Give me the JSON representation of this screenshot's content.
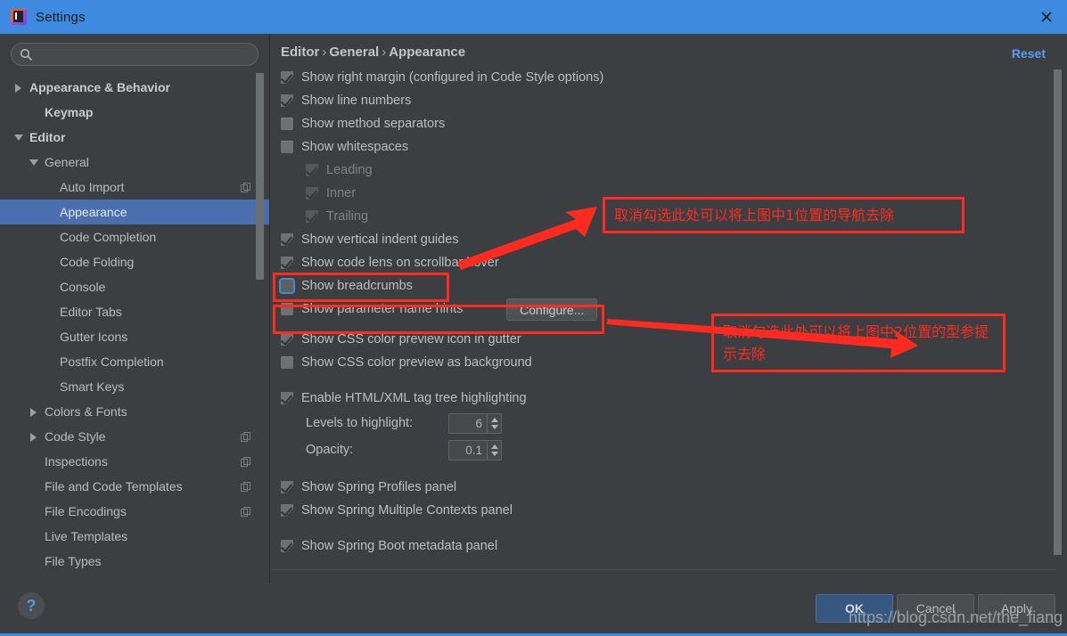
{
  "window": {
    "title": "Settings",
    "icon": "intellij-idea-icon",
    "close_label": "×"
  },
  "sidebar": {
    "search": {
      "placeholder": "",
      "value": "",
      "icon": "search-icon"
    },
    "items": [
      {
        "label": "Appearance & Behavior",
        "indent": 0,
        "arrow": "right",
        "bold": true,
        "selected": false,
        "copy": false
      },
      {
        "label": "Keymap",
        "indent": 1,
        "arrow": "none",
        "bold": true,
        "selected": false,
        "copy": false
      },
      {
        "label": "Editor",
        "indent": 0,
        "arrow": "down",
        "bold": true,
        "selected": false,
        "copy": false
      },
      {
        "label": "General",
        "indent": 1,
        "arrow": "down",
        "bold": false,
        "selected": false,
        "copy": false
      },
      {
        "label": "Auto Import",
        "indent": 2,
        "arrow": "none",
        "bold": false,
        "selected": false,
        "copy": true
      },
      {
        "label": "Appearance",
        "indent": 2,
        "arrow": "none",
        "bold": false,
        "selected": true,
        "copy": false
      },
      {
        "label": "Code Completion",
        "indent": 2,
        "arrow": "none",
        "bold": false,
        "selected": false,
        "copy": false
      },
      {
        "label": "Code Folding",
        "indent": 2,
        "arrow": "none",
        "bold": false,
        "selected": false,
        "copy": false
      },
      {
        "label": "Console",
        "indent": 2,
        "arrow": "none",
        "bold": false,
        "selected": false,
        "copy": false
      },
      {
        "label": "Editor Tabs",
        "indent": 2,
        "arrow": "none",
        "bold": false,
        "selected": false,
        "copy": false
      },
      {
        "label": "Gutter Icons",
        "indent": 2,
        "arrow": "none",
        "bold": false,
        "selected": false,
        "copy": false
      },
      {
        "label": "Postfix Completion",
        "indent": 2,
        "arrow": "none",
        "bold": false,
        "selected": false,
        "copy": false
      },
      {
        "label": "Smart Keys",
        "indent": 2,
        "arrow": "none",
        "bold": false,
        "selected": false,
        "copy": false
      },
      {
        "label": "Colors & Fonts",
        "indent": 1,
        "arrow": "right",
        "bold": false,
        "selected": false,
        "copy": false
      },
      {
        "label": "Code Style",
        "indent": 1,
        "arrow": "right",
        "bold": false,
        "selected": false,
        "copy": true
      },
      {
        "label": "Inspections",
        "indent": 1,
        "arrow": "none",
        "bold": false,
        "selected": false,
        "copy": true
      },
      {
        "label": "File and Code Templates",
        "indent": 1,
        "arrow": "none",
        "bold": false,
        "selected": false,
        "copy": true
      },
      {
        "label": "File Encodings",
        "indent": 1,
        "arrow": "none",
        "bold": false,
        "selected": false,
        "copy": true
      },
      {
        "label": "Live Templates",
        "indent": 1,
        "arrow": "none",
        "bold": false,
        "selected": false,
        "copy": false
      },
      {
        "label": "File Types",
        "indent": 1,
        "arrow": "none",
        "bold": false,
        "selected": false,
        "copy": false
      }
    ]
  },
  "content": {
    "breadcrumb": {
      "part1": "Editor",
      "part2": "General",
      "part3": "Appearance",
      "separator": "›"
    },
    "reset_label": "Reset",
    "options": [
      {
        "label": "Show right margin (configured in Code Style options)",
        "state": "checked",
        "indent": false,
        "disabled": false
      },
      {
        "label": "Show line numbers",
        "state": "checked",
        "indent": false,
        "disabled": false
      },
      {
        "label": "Show method separators",
        "state": "unchecked",
        "indent": false,
        "disabled": false
      },
      {
        "label": "Show whitespaces",
        "state": "unchecked",
        "indent": false,
        "disabled": false
      },
      {
        "label": "Leading",
        "state": "checked",
        "indent": true,
        "disabled": true
      },
      {
        "label": "Inner",
        "state": "checked",
        "indent": true,
        "disabled": true
      },
      {
        "label": "Trailing",
        "state": "checked",
        "indent": true,
        "disabled": true
      },
      {
        "label": "Show vertical indent guides",
        "state": "checked",
        "indent": false,
        "disabled": false
      },
      {
        "label": "Show code lens on scrollbar hover",
        "state": "checked",
        "indent": false,
        "disabled": false
      },
      {
        "label": "Show breadcrumbs",
        "state": "focused",
        "indent": false,
        "disabled": false
      },
      {
        "label": "Show parameter name hints",
        "state": "unchecked",
        "indent": false,
        "disabled": false,
        "button": "Configure..."
      },
      {
        "label": "Show CSS color preview icon in gutter",
        "state": "checked",
        "indent": false,
        "disabled": false
      },
      {
        "label": "Show CSS color preview as background",
        "state": "unchecked",
        "indent": false,
        "disabled": false
      }
    ],
    "html_section": {
      "label": "Enable HTML/XML tag tree highlighting",
      "state": "checked",
      "levels_label": "Levels to highlight:",
      "levels_value": "6",
      "opacity_label": "Opacity:",
      "opacity_value": "0.1"
    },
    "spring_options": [
      {
        "label": "Show Spring Profiles panel",
        "state": "checked"
      },
      {
        "label": "Show Spring Multiple Contexts panel",
        "state": "checked"
      },
      {
        "label": "Show Spring Boot metadata panel",
        "state": "checked"
      }
    ]
  },
  "annotations": [
    {
      "text": "取消勾选此处可以将上图中1位置的导航去除",
      "color": "#ff2a20"
    },
    {
      "text": "取消勾选此处可以将上图中2位置的型参提示去除",
      "color": "#ff2a20"
    }
  ],
  "footer": {
    "help_label": "?",
    "ok_label": "OK",
    "cancel_label": "Cancel",
    "apply_label": "Apply"
  },
  "watermark": "https://blog.csdn.net/the_fiang",
  "colors": {
    "titlebar": "#3d8ae0",
    "background": "#3c3f41",
    "selection": "#4b6eaf",
    "link": "#589df6",
    "annotation": "#ff2a20",
    "ok_button": "#365880"
  }
}
